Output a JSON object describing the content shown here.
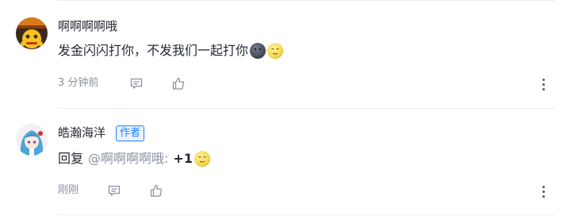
{
  "comments": [
    {
      "user": "啊啊啊啊哦",
      "text": "发金闪闪打你，不发我们一起打你",
      "emojis": [
        "dark-moon-emoji",
        "moon-face-emoji"
      ],
      "time": "3 分钟前"
    },
    {
      "user": "皓瀚海洋",
      "badge": "作者",
      "reply_prefix": "回复",
      "mention": "@啊啊啊啊哦:",
      "text": "+1",
      "emojis": [
        "moon-face-emoji"
      ],
      "time": "刚刚"
    }
  ],
  "icons": {
    "reply": "comment-icon",
    "like": "thumbs-up-icon",
    "more": "more-vertical-icon"
  },
  "colors": {
    "accent": "#1e80ff",
    "text": "#252933",
    "muted": "#8a919f"
  }
}
